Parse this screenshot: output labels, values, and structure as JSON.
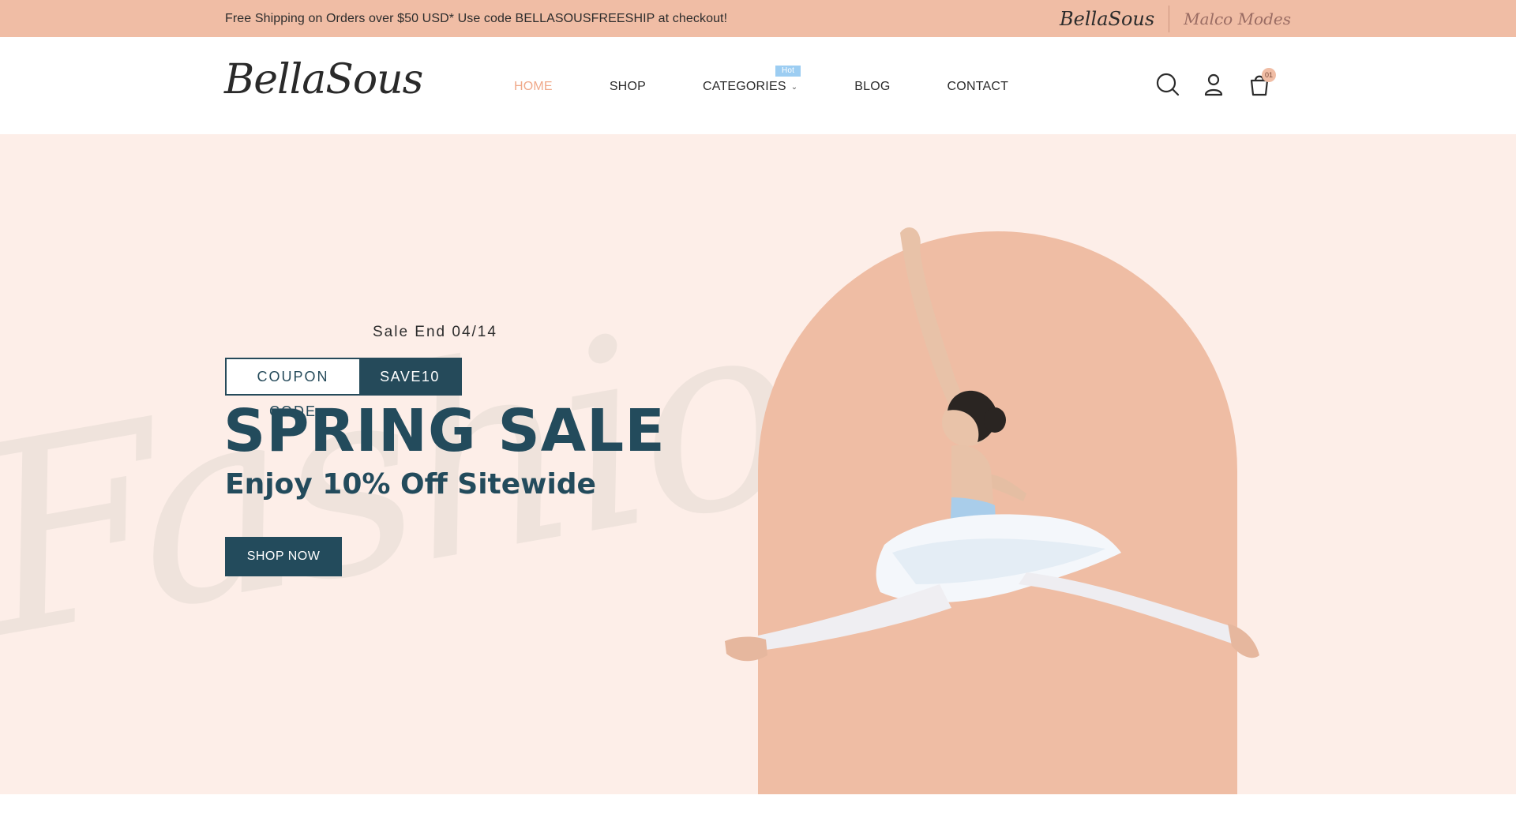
{
  "topbar": {
    "message": "Free Shipping on Orders over $50 USD* Use code BELLASOUSFREESHIP at checkout!",
    "brands": [
      "BellaSous",
      "Malco Modes"
    ]
  },
  "header": {
    "logo": "BellaSous",
    "nav": [
      {
        "label": "HOME",
        "active": true
      },
      {
        "label": "SHOP"
      },
      {
        "label": "CATEGORIES",
        "badge": "Hot"
      },
      {
        "label": "BLOG"
      },
      {
        "label": "CONTACT"
      }
    ],
    "icons": [
      "search-icon",
      "account-icon",
      "cart-icon"
    ],
    "cart_count": "01"
  },
  "hero": {
    "sale_end": "Sale End 04/14",
    "coupon_label": "COUPON CODE",
    "coupon_code": "SAVE10",
    "headline": "SPRING SALE",
    "subhead": "Enjoy 10% Off Sitewide",
    "cta": "SHOP NOW",
    "watermark": "Fashion"
  },
  "colors": {
    "topbar_bg": "#f0bda5",
    "hero_bg": "#fdeee8",
    "arch": "#efbda4",
    "primary": "#234b5c",
    "nav_active": "#f0a98a",
    "hot_badge": "#9ccdf2"
  }
}
